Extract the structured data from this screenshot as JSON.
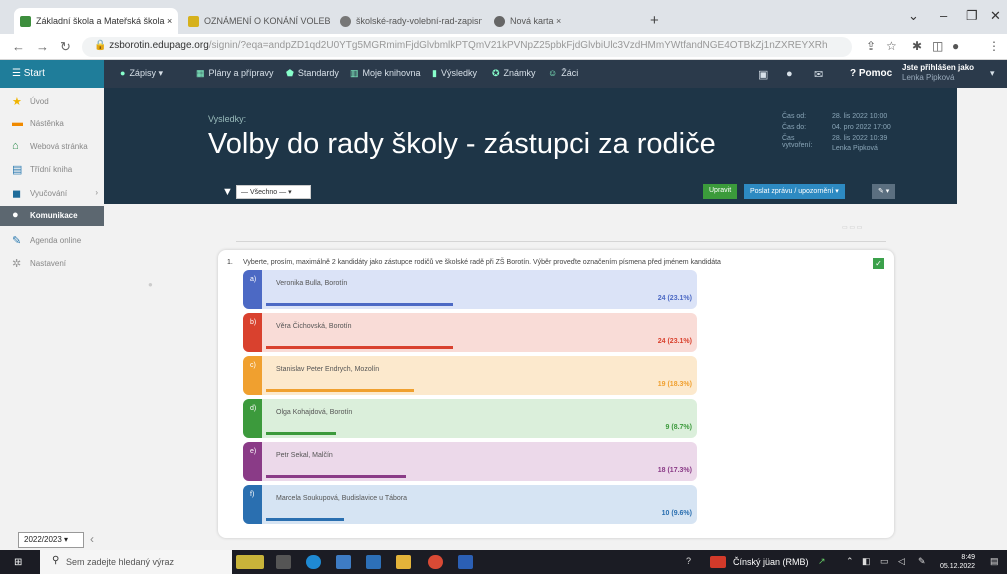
{
  "browser": {
    "tabs": [
      {
        "title": "Základní škola a Mateřská škola ×",
        "active": true
      },
      {
        "title": "OZNÁMENÍ O KONÁNÍ VOLEB D ×",
        "active": false
      },
      {
        "title": "školské-rady-volební-rad-zapisn ×",
        "active": false
      },
      {
        "title": "Nová karta ×",
        "active": false
      }
    ],
    "url_host": "zsborotin.edupage.org",
    "url_path": "/signin/?eqa=andpZD1qd2U0YTg5MGRmimFjdGlvbmlkPTQmV21kPVNpZ25pbkFjdGlvbiUlc3VzdHMmYWtfandNGE4OTBkZj1nZXREYXRh"
  },
  "header": {
    "start_label": "Start",
    "menu": [
      "Zápisy",
      "Plány a přípravy",
      "Standardy",
      "Moje knihovna",
      "Výsledky",
      "Známky",
      "Žáci"
    ],
    "help_label": "Pomoc",
    "user_line1": "Jste přihlášen jako",
    "user_line2": "Lenka Pipková"
  },
  "sidebar": {
    "items": [
      "Úvod",
      "Nástěnka",
      "Webová stránka",
      "Třídní kniha",
      "Vyučování",
      "Komunikace",
      "Agenda online",
      "Nastavení"
    ],
    "year": "2022/2023"
  },
  "page": {
    "label": "Vysledky:",
    "title": "Volby do rady školy - zástupci za rodiče",
    "meta": [
      {
        "key": "Čas od:",
        "value": "28. lis 2022 10:00"
      },
      {
        "key": "Čas do:",
        "value": "04. pro 2022 17:00"
      },
      {
        "key": "Čas vytvoření:",
        "value": "28. lis 2022 10:39"
      },
      {
        "key": "",
        "value": "Lenka Pipková"
      }
    ]
  },
  "toolbar": {
    "filter_value": "— Všechno —",
    "edit_label": "Upravit",
    "send_label": "Poslat zprávu / upozornění ▾",
    "tools_label": "✎ ▾"
  },
  "poll": {
    "question_no": "1.",
    "question": "Vyberte, prosím, maximálně 2 kandidáty jako zástupce rodičů ve školské radě při ZŠ Borotín. Výběr proveďte označením písmena před jménem kandidáta",
    "options": [
      {
        "letter": "a)",
        "name": "Veronika Bulla, Borotín",
        "votes": "24 (23.1%)",
        "percent": 23.1,
        "color": "#4c69c4",
        "tint": "#dbe3f7"
      },
      {
        "letter": "b)",
        "name": "Věra Čichovská, Borotín",
        "votes": "24 (23.1%)",
        "percent": 23.1,
        "color": "#d9412e",
        "tint": "#f9dcd7"
      },
      {
        "letter": "c)",
        "name": "Stanislav Peter Endrych, Mozolín",
        "votes": "19 (18.3%)",
        "percent": 18.3,
        "color": "#f0a02f",
        "tint": "#fce9cd"
      },
      {
        "letter": "d)",
        "name": "Olga Kohajdová, Borotín",
        "votes": "9 (8.7%)",
        "percent": 8.7,
        "color": "#3c9a3c",
        "tint": "#dbefdb"
      },
      {
        "letter": "e)",
        "name": "Petr Sekal, Malčín",
        "votes": "18 (17.3%)",
        "percent": 17.3,
        "color": "#8a3b87",
        "tint": "#ecd9ea"
      },
      {
        "letter": "f)",
        "name": "Marcela Soukupová, Budislavice u Tábora",
        "votes": "10 (9.6%)",
        "percent": 9.6,
        "color": "#2a6fb0",
        "tint": "#d6e4f3"
      }
    ]
  },
  "taskbar": {
    "search_placeholder": "Sem zadejte hledaný výraz",
    "weather": "Čínský jüan (RMB)",
    "time": "8:49",
    "date": "05.12.2022"
  }
}
